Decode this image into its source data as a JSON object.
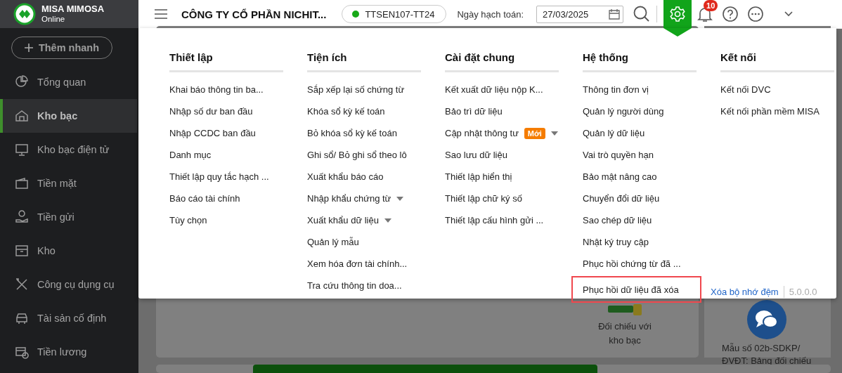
{
  "app": {
    "name": "MISA MIMOSA",
    "edition": "Online"
  },
  "quick_add": {
    "label": "Thêm nhanh"
  },
  "sidebar": {
    "items": [
      {
        "label": "Tổng quan",
        "selected": false
      },
      {
        "label": "Kho bạc",
        "selected": true
      },
      {
        "label": "Kho bạc điện tử",
        "selected": false
      },
      {
        "label": "Tiền mặt",
        "selected": false
      },
      {
        "label": "Tiền gửi",
        "selected": false
      },
      {
        "label": "Kho",
        "selected": false
      },
      {
        "label": "Công cụ dụng cụ",
        "selected": false
      },
      {
        "label": "Tài sản cố định",
        "selected": false
      },
      {
        "label": "Tiền lương",
        "selected": false
      }
    ]
  },
  "topbar": {
    "company": "CÔNG TY CỔ PHẦN NICHIT...",
    "unit": "TTSEN107-TT24",
    "date_label": "Ngày hạch toán:",
    "date": "27/03/2025",
    "notification_count": "10"
  },
  "settings_menu": {
    "columns": [
      {
        "title": "Thiết lập",
        "items": [
          {
            "label": "Khai báo thông tin ba...",
            "has_submenu": false,
            "highlighted": false
          },
          {
            "label": "Nhập số dư ban đầu",
            "has_submenu": false,
            "highlighted": false
          },
          {
            "label": "Nhập CCDC ban đầu",
            "has_submenu": false,
            "highlighted": false
          },
          {
            "label": "Danh mục",
            "has_submenu": false,
            "highlighted": false
          },
          {
            "label": "Thiết lập quy tắc hạch ...",
            "has_submenu": false,
            "highlighted": false
          },
          {
            "label": "Báo cáo tài chính",
            "has_submenu": false,
            "highlighted": false
          },
          {
            "label": "Tùy chọn",
            "has_submenu": false,
            "highlighted": false
          }
        ]
      },
      {
        "title": "Tiện ích",
        "items": [
          {
            "label": "Sắp xếp lại số chứng từ",
            "has_submenu": false,
            "highlighted": false
          },
          {
            "label": "Khóa sổ kỳ kế toán",
            "has_submenu": false,
            "highlighted": false
          },
          {
            "label": "Bỏ khóa sổ kỳ kế toán",
            "has_submenu": false,
            "highlighted": false
          },
          {
            "label": "Ghi sổ/ Bỏ ghi sổ theo lô",
            "has_submenu": false,
            "highlighted": false
          },
          {
            "label": "Xuất khẩu báo cáo",
            "has_submenu": false,
            "highlighted": false
          },
          {
            "label": "Nhập khẩu chứng từ",
            "has_submenu": true,
            "highlighted": false
          },
          {
            "label": "Xuất khẩu dữ liệu",
            "has_submenu": true,
            "highlighted": false
          },
          {
            "label": "Quản lý mẫu",
            "has_submenu": false,
            "highlighted": false
          },
          {
            "label": "Xem hóa đơn tài chính...",
            "has_submenu": false,
            "highlighted": false
          },
          {
            "label": "Tra cứu thông tin doa...",
            "has_submenu": false,
            "highlighted": false
          }
        ]
      },
      {
        "title": "Cài đặt chung",
        "items": [
          {
            "label": "Kết xuất dữ liệu nộp K...",
            "has_submenu": false,
            "highlighted": false
          },
          {
            "label": "Bảo trì dữ liệu",
            "has_submenu": false,
            "highlighted": false
          },
          {
            "label": "Cập nhật thông tư",
            "badge": "Mới",
            "has_submenu": true,
            "highlighted": false
          },
          {
            "label": "Sao lưu dữ liệu",
            "has_submenu": false,
            "highlighted": false
          },
          {
            "label": "Thiết lập hiển thị",
            "has_submenu": false,
            "highlighted": false
          },
          {
            "label": "Thiết lập chữ ký số",
            "has_submenu": false,
            "highlighted": false
          },
          {
            "label": "Thiết lập cấu hình gửi ...",
            "has_submenu": false,
            "highlighted": false
          }
        ]
      },
      {
        "title": "Hệ thống",
        "items": [
          {
            "label": "Thông tin đơn vị",
            "has_submenu": false,
            "highlighted": false
          },
          {
            "label": "Quản lý người dùng",
            "has_submenu": false,
            "highlighted": false
          },
          {
            "label": "Quản lý dữ liệu",
            "has_submenu": false,
            "highlighted": false
          },
          {
            "label": "Vai trò quyền hạn",
            "has_submenu": false,
            "highlighted": false
          },
          {
            "label": "Bảo mật nâng cao",
            "has_submenu": false,
            "highlighted": false
          },
          {
            "label": "Chuyển đổi dữ liệu",
            "has_submenu": false,
            "highlighted": false
          },
          {
            "label": "Sao chép dữ liệu",
            "has_submenu": false,
            "highlighted": false
          },
          {
            "label": "Nhật ký truy cập",
            "has_submenu": false,
            "highlighted": false
          },
          {
            "label": "Phục hồi chứng từ đã ...",
            "has_submenu": false,
            "highlighted": false
          },
          {
            "label": "Phục hồi dữ liệu đã xóa",
            "has_submenu": false,
            "highlighted": true
          }
        ]
      },
      {
        "title": "Kết nối",
        "items": [
          {
            "label": "Kết nối DVC",
            "has_submenu": false,
            "highlighted": false
          },
          {
            "label": "Kết nối phần mềm MISA",
            "has_submenu": false,
            "highlighted": false
          }
        ]
      }
    ],
    "clear_cache": "Xóa bộ nhớ đệm",
    "version": "5.0.0.0"
  },
  "background": {
    "tile_label": "Đối chiếu với kho bạc",
    "side_text": "Mẫu số 02b-SDKP/ ĐVĐT: Bảng đối chiếu"
  }
}
